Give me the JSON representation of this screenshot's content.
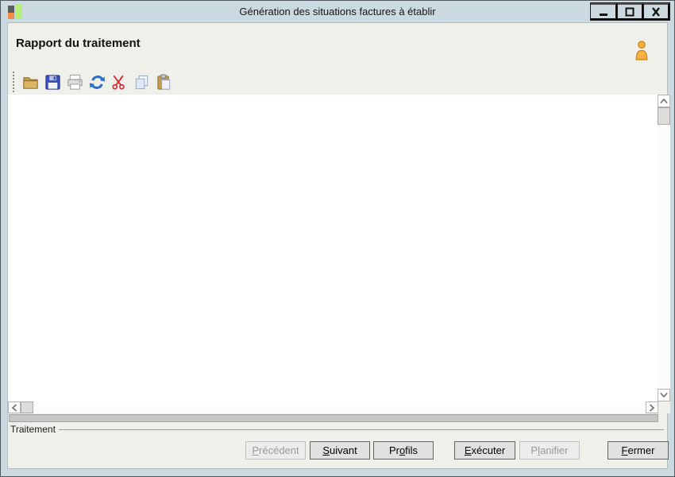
{
  "window": {
    "title": "Génération des situations factures à établir",
    "controls": {
      "minimize": "minimize-button",
      "maximize": "maximize-button",
      "close": "close-button"
    }
  },
  "header": {
    "title": "Rapport du traitement"
  },
  "toolbar": {
    "icons": [
      "open-folder-icon",
      "save-icon",
      "print-icon",
      "refresh-icon",
      "cut-icon",
      "copy-icon",
      "paste-icon"
    ]
  },
  "report": {
    "content": ""
  },
  "footer": {
    "group_label": "Traitement",
    "buttons": [
      {
        "id": "precedent",
        "pre": "",
        "key": "P",
        "post": "récédent",
        "enabled": false
      },
      {
        "id": "suivant",
        "pre": "",
        "key": "S",
        "post": "uivant",
        "enabled": true
      },
      {
        "id": "profils",
        "pre": "Pr",
        "key": "o",
        "post": "fils",
        "enabled": true
      },
      {
        "id": "executer",
        "pre": "",
        "key": "E",
        "post": "xécuter",
        "enabled": true
      },
      {
        "id": "planifier",
        "pre": "P",
        "key": "l",
        "post": "anifier",
        "enabled": false
      },
      {
        "id": "fermer",
        "pre": "",
        "key": "F",
        "post": "ermer",
        "enabled": true
      }
    ]
  },
  "colors": {
    "titlebar": "#cbdae0",
    "content_bg": "#f0f0eb",
    "report_bg": "#ffffff",
    "progress_bar": "#c6c6c6",
    "disabled_text": "#9a9a9a",
    "folder_icon": "#d9b15f",
    "save_icon": "#3a50c2",
    "refresh_icon": "#2c6fce",
    "cut_icon": "#cc3333",
    "paste_icon": "#c79b52",
    "user_icon": "#f6b23d"
  }
}
